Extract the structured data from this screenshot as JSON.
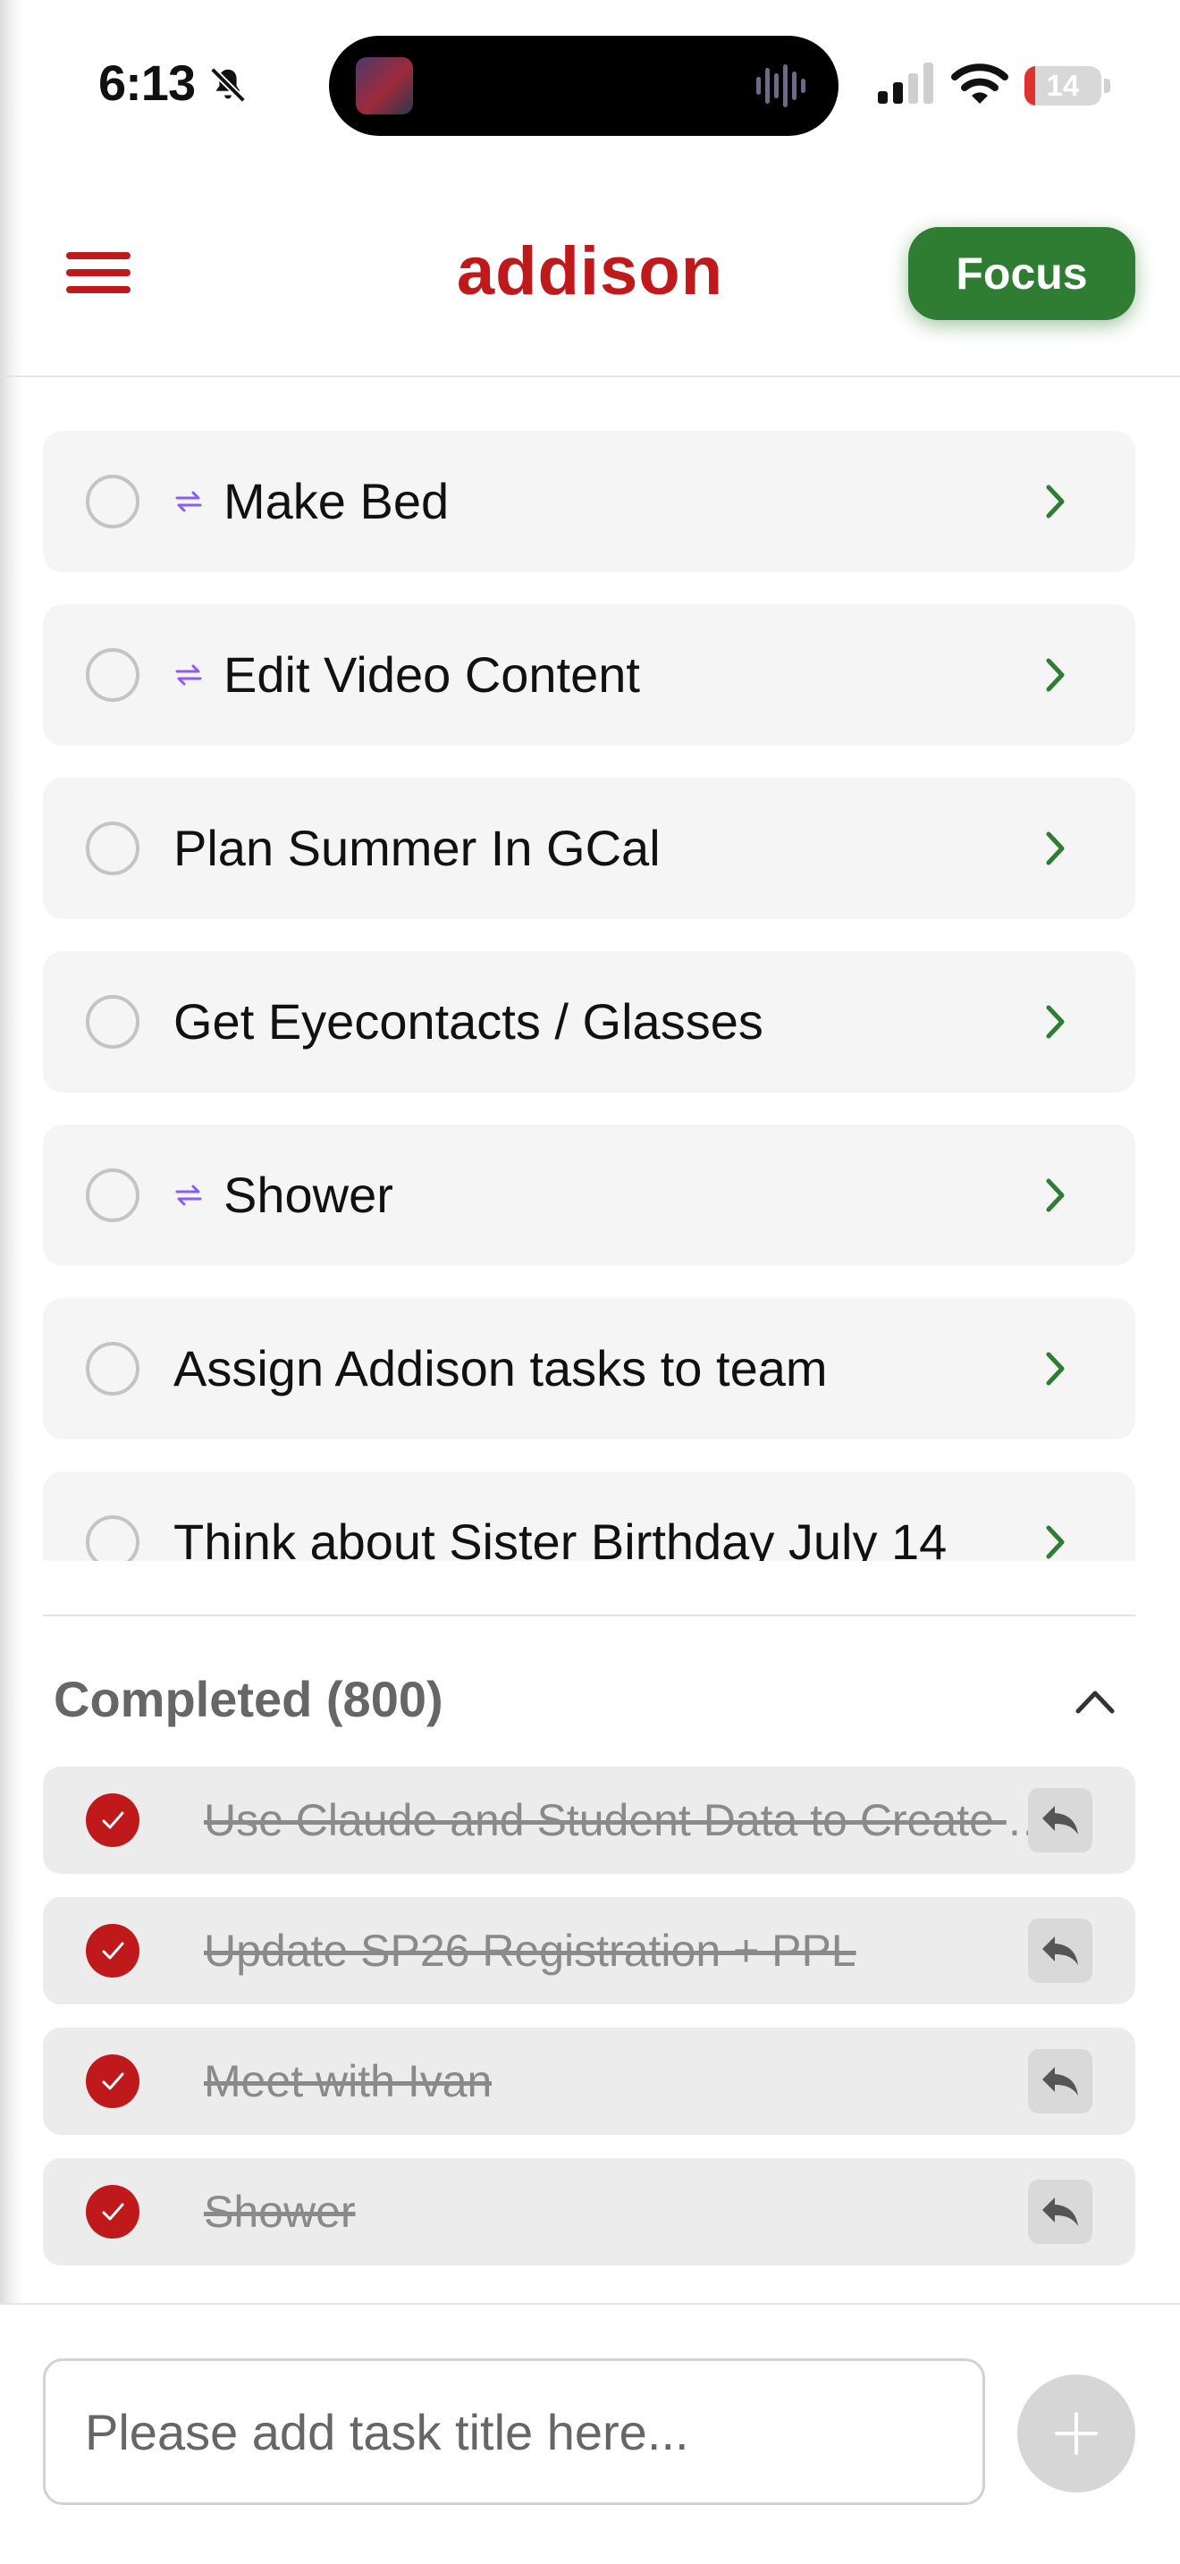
{
  "status_bar": {
    "time": "6:13",
    "battery_level": "14",
    "battery_fraction": 0.14
  },
  "header": {
    "title": "addison",
    "focus_label": "Focus"
  },
  "colors": {
    "brand_red": "#c0191c",
    "focus_green": "#2e7d32",
    "chevron_green": "#2e7d32",
    "repeat_purple": "#8b5cf6"
  },
  "tasks": [
    {
      "title": "Make Bed",
      "repeating": true
    },
    {
      "title": "Edit Video Content",
      "repeating": true
    },
    {
      "title": "Plan Summer In GCal",
      "repeating": false
    },
    {
      "title": "Get Eyecontacts / Glasses",
      "repeating": false
    },
    {
      "title": "Shower",
      "repeating": true
    },
    {
      "title": "Assign Addison tasks to team",
      "repeating": false
    },
    {
      "title": "Think about Sister Birthday July 14",
      "repeating": false
    }
  ],
  "completed": {
    "label": "Completed (800)",
    "items": [
      {
        "title": "Use Claude and Student Data to Create Plan"
      },
      {
        "title": "Update SP26 Registration + PPL"
      },
      {
        "title": "Meet with Ivan"
      },
      {
        "title": "Shower"
      }
    ]
  },
  "new_task": {
    "placeholder": "Please add task title here..."
  },
  "icons": {
    "menu": "hamburger-icon",
    "repeat": "repeat-icon",
    "row_chevron": "chevron-right-icon",
    "collapse": "chevron-up-icon",
    "undo": "undo-arrow-icon",
    "add": "plus-icon"
  }
}
